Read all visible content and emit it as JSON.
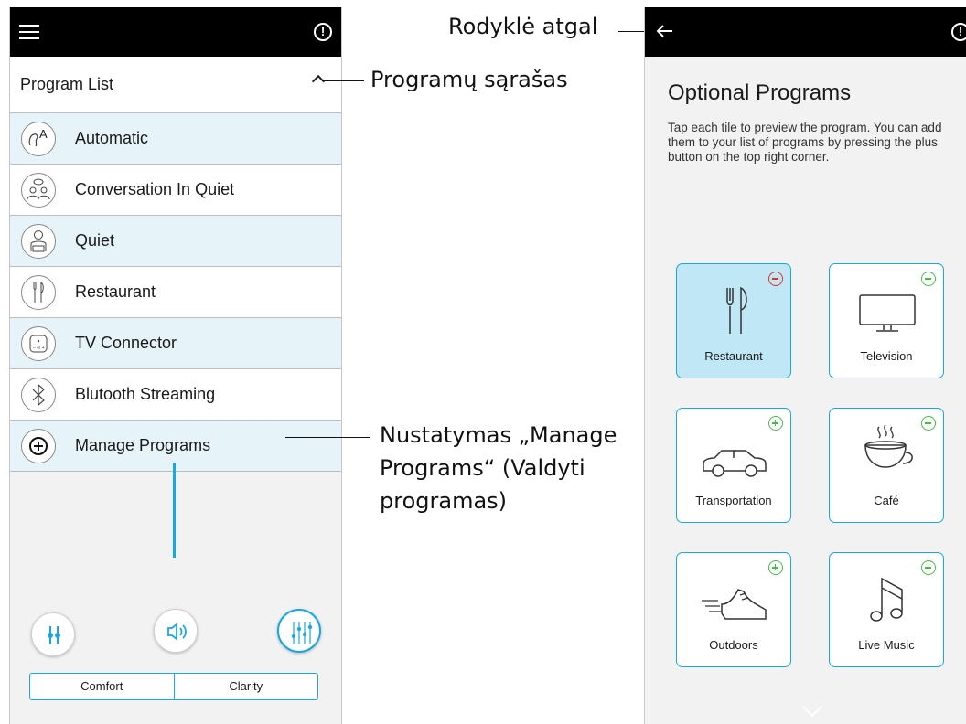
{
  "left_app": {
    "list_header": "Program List",
    "programs": [
      {
        "label": "Automatic",
        "icon": "automatic-icon"
      },
      {
        "label": "Conversation In Quiet",
        "icon": "conversation-icon"
      },
      {
        "label": "Quiet",
        "icon": "quiet-icon"
      },
      {
        "label": "Restaurant",
        "icon": "restaurant-icon"
      },
      {
        "label": "TV Connector",
        "icon": "tv-connector-icon"
      },
      {
        "label": "Blutooth Streaming",
        "icon": "bluetooth-icon"
      },
      {
        "label": "Manage Programs",
        "icon": "plus-circle-icon"
      }
    ],
    "segment": {
      "left": "Comfort",
      "right": "Clarity"
    }
  },
  "annotations": {
    "back_arrow": "Rodyklė atgal",
    "program_list": "Programų sąrašas",
    "manage_line1": "Nustatymas „Manage",
    "manage_line2": "Programs“ (Valdyti",
    "manage_line3": "programas)"
  },
  "right_app": {
    "title": "Optional Programs",
    "description": "Tap each tile to preview the program. You can add them to your list of programs by pressing the plus button on the top right corner.",
    "tiles": [
      {
        "label": "Restaurant",
        "icon": "cutlery-icon",
        "selected": true,
        "badge": "minus"
      },
      {
        "label": "Television",
        "icon": "television-icon",
        "selected": false,
        "badge": "plus"
      },
      {
        "label": "Transportation",
        "icon": "car-icon",
        "selected": false,
        "badge": "plus"
      },
      {
        "label": "Café",
        "icon": "coffee-cup-icon",
        "selected": false,
        "badge": "plus"
      },
      {
        "label": "Outdoors",
        "icon": "sneaker-icon",
        "selected": false,
        "badge": "plus"
      },
      {
        "label": "Live Music",
        "icon": "music-note-icon",
        "selected": false,
        "badge": "plus"
      }
    ]
  },
  "colors": {
    "accent": "#1aa7e1",
    "row_highlight": "#e6f4f9",
    "tile_selected": "#bfe7f6",
    "add_green": "#4cb84c",
    "remove_red": "#e0322b"
  }
}
